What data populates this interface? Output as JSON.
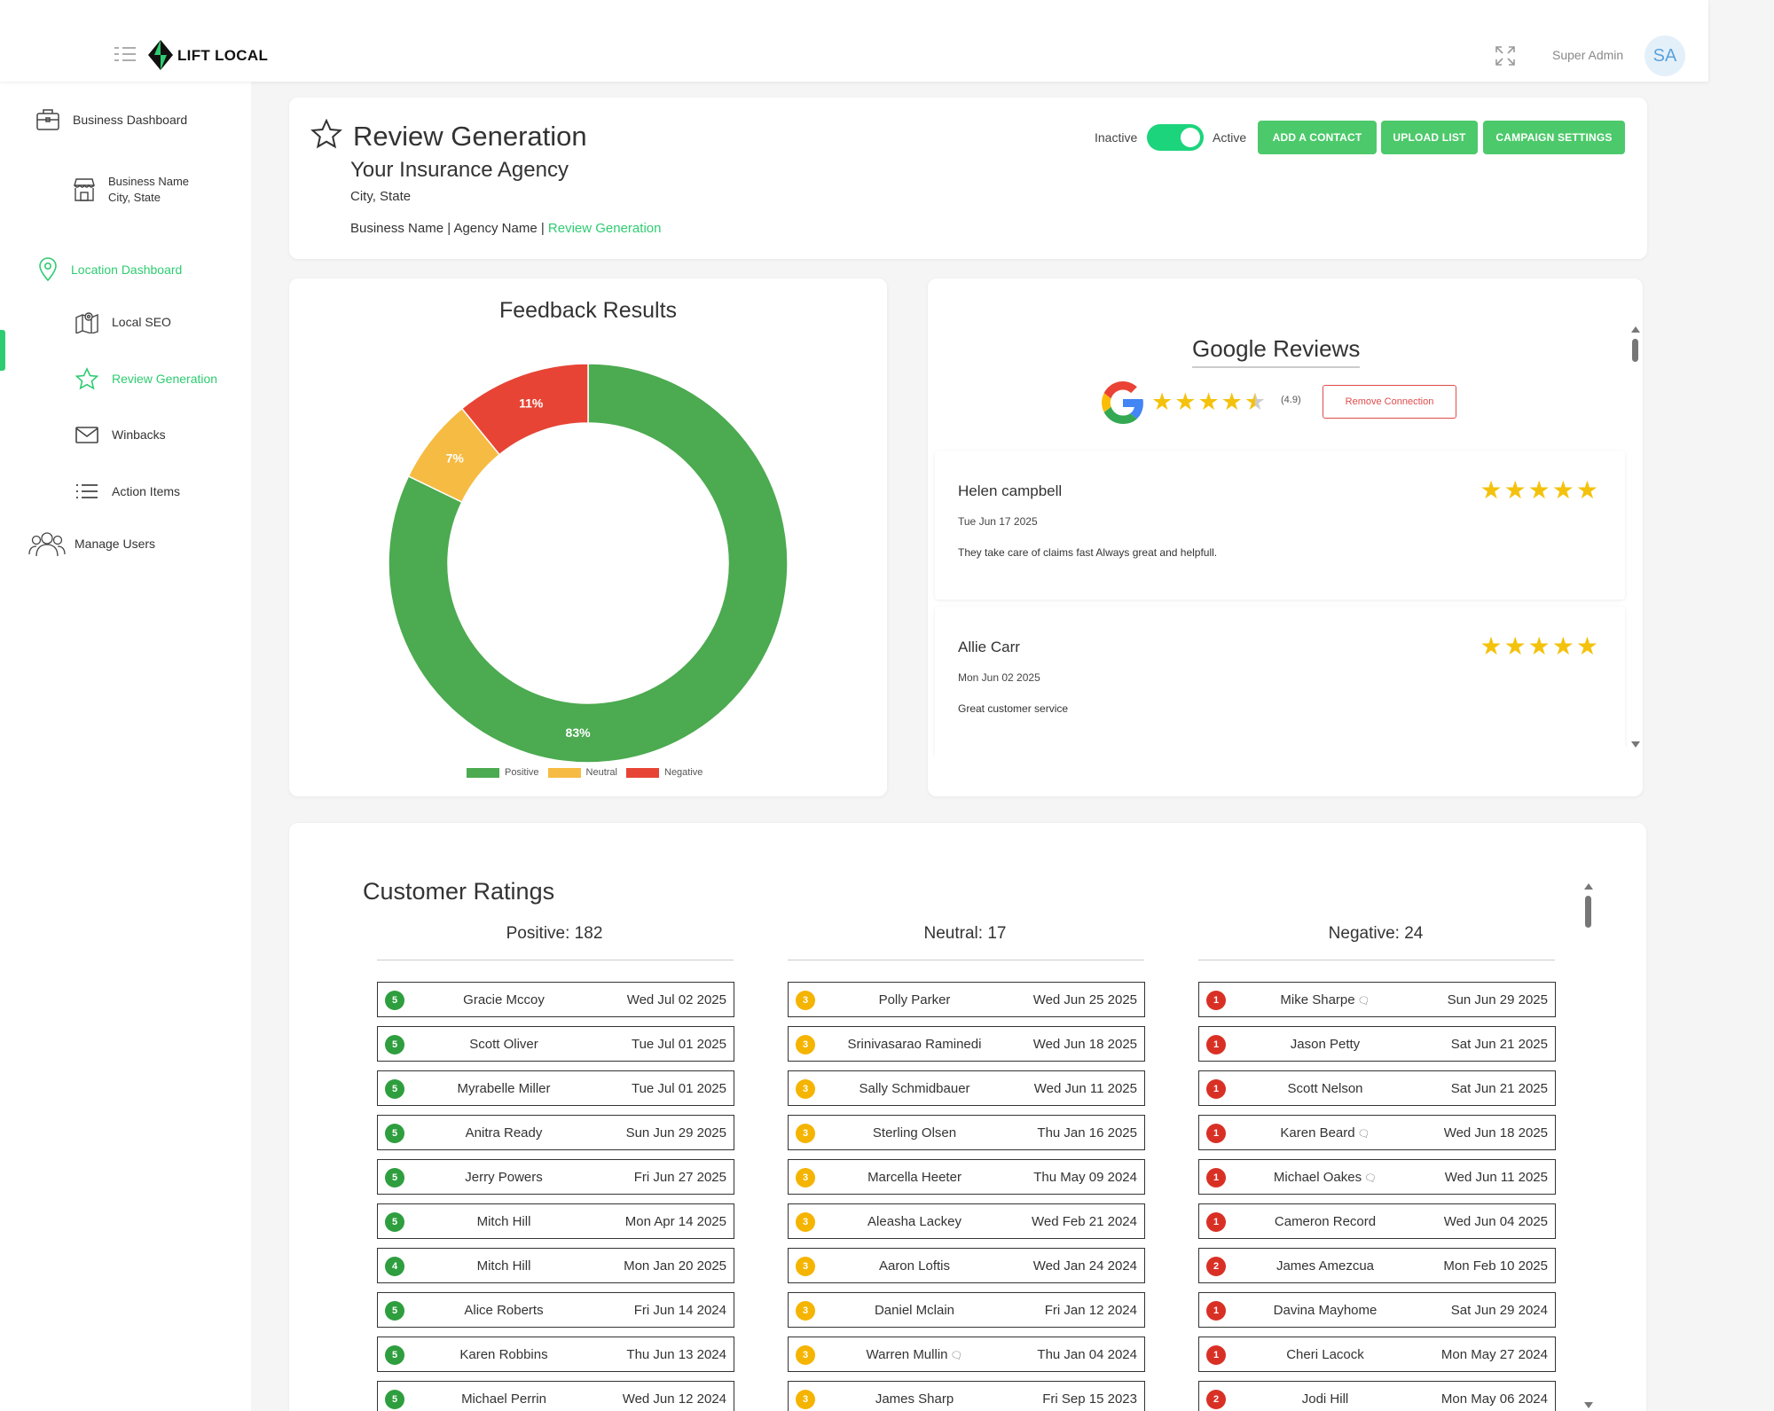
{
  "app": {
    "logo_text": "LIFT LOCAL",
    "user_name": "Super Admin",
    "avatar_initials": "SA"
  },
  "sidebar": {
    "business_dashboard": "Business Dashboard",
    "business_name_line1": "Business Name",
    "business_name_line2": "City, State",
    "location_dashboard": "Location Dashboard",
    "local_seo": "Local SEO",
    "review_generation": "Review Generation",
    "winbacks": "Winbacks",
    "action_items": "Action Items",
    "manage_users": "Manage Users"
  },
  "header": {
    "title": "Review Generation",
    "agency": "Your Insurance Agency",
    "location": "City, State",
    "breadcrumb_prefix": "Business Name | Agency Name | ",
    "breadcrumb_current": "Review Generation",
    "toggle_off_label": "Inactive",
    "toggle_on_label": "Active",
    "toggle_state": true,
    "btn_add_contact": "ADD A CONTACT",
    "btn_upload_list": "UPLOAD LIST",
    "btn_campaign_settings": "CAMPAIGN SETTINGS"
  },
  "colors": {
    "accent": "#2ecc71",
    "positive": "#4caa50",
    "neutral": "#f6bb42",
    "negative": "#e74435",
    "star": "#f4c20d"
  },
  "chart_data": {
    "type": "pie",
    "title": "Feedback Results",
    "categories": [
      "Positive",
      "Neutral",
      "Negative"
    ],
    "values": [
      83,
      7,
      11
    ],
    "labels": [
      "83%",
      "7%",
      "11%"
    ],
    "colors": [
      "#4caa50",
      "#f6bb42",
      "#e74435"
    ],
    "legend": "bottom",
    "donut": true
  },
  "google": {
    "title": "Google Reviews",
    "rating": 4.5,
    "score_text": "(4.9)",
    "remove_label": "Remove Connection",
    "reviews": [
      {
        "name": "Helen campbell",
        "date": "Tue Jun 17 2025",
        "text": "They take care of claims fast Always great and helpfull.",
        "stars": 5
      },
      {
        "name": "Allie Carr",
        "date": "Mon Jun 02 2025",
        "text": "Great customer service",
        "stars": 5
      }
    ]
  },
  "ratings": {
    "title": "Customer Ratings",
    "columns": [
      {
        "header": "Positive: 182",
        "color": "#2e9e3e",
        "rows": [
          {
            "score": "5",
            "name": "Gracie Mccoy",
            "date": "Wed Jul 02 2025",
            "comment": false
          },
          {
            "score": "5",
            "name": "Scott Oliver",
            "date": "Tue Jul 01 2025",
            "comment": false
          },
          {
            "score": "5",
            "name": "Myrabelle Miller",
            "date": "Tue Jul 01 2025",
            "comment": false
          },
          {
            "score": "5",
            "name": "Anitra Ready",
            "date": "Sun Jun 29 2025",
            "comment": false
          },
          {
            "score": "5",
            "name": "Jerry Powers",
            "date": "Fri Jun 27 2025",
            "comment": false
          },
          {
            "score": "5",
            "name": "Mitch Hill",
            "date": "Mon Apr 14 2025",
            "comment": false
          },
          {
            "score": "4",
            "name": "Mitch Hill",
            "date": "Mon Jan 20 2025",
            "comment": false
          },
          {
            "score": "5",
            "name": "Alice Roberts",
            "date": "Fri Jun 14 2024",
            "comment": false
          },
          {
            "score": "5",
            "name": "Karen Robbins",
            "date": "Thu Jun 13 2024",
            "comment": false
          },
          {
            "score": "5",
            "name": "Michael Perrin",
            "date": "Wed Jun 12 2024",
            "comment": false
          }
        ]
      },
      {
        "header": "Neutral: 17",
        "color": "#f4b400",
        "rows": [
          {
            "score": "3",
            "name": "Polly Parker",
            "date": "Wed Jun 25 2025",
            "comment": false
          },
          {
            "score": "3",
            "name": "Srinivasarao Raminedi",
            "date": "Wed Jun 18 2025",
            "comment": false
          },
          {
            "score": "3",
            "name": "Sally Schmidbauer",
            "date": "Wed Jun 11 2025",
            "comment": false
          },
          {
            "score": "3",
            "name": "Sterling Olsen",
            "date": "Thu Jan 16 2025",
            "comment": false
          },
          {
            "score": "3",
            "name": "Marcella Heeter",
            "date": "Thu May 09 2024",
            "comment": false
          },
          {
            "score": "3",
            "name": "Aleasha Lackey",
            "date": "Wed Feb 21 2024",
            "comment": false
          },
          {
            "score": "3",
            "name": "Aaron Loftis",
            "date": "Wed Jan 24 2024",
            "comment": false
          },
          {
            "score": "3",
            "name": "Daniel Mclain",
            "date": "Fri Jan 12 2024",
            "comment": false
          },
          {
            "score": "3",
            "name": "Warren Mullin",
            "date": "Thu Jan 04 2024",
            "comment": true
          },
          {
            "score": "3",
            "name": "James Sharp",
            "date": "Fri Sep 15 2023",
            "comment": false
          }
        ]
      },
      {
        "header": "Negative: 24",
        "color": "#d93025",
        "rows": [
          {
            "score": "1",
            "name": "Mike Sharpe",
            "date": "Sun Jun 29 2025",
            "comment": true
          },
          {
            "score": "1",
            "name": "Jason Petty",
            "date": "Sat Jun 21 2025",
            "comment": false
          },
          {
            "score": "1",
            "name": "Scott Nelson",
            "date": "Sat Jun 21 2025",
            "comment": false
          },
          {
            "score": "1",
            "name": "Karen Beard",
            "date": "Wed Jun 18 2025",
            "comment": true
          },
          {
            "score": "1",
            "name": "Michael Oakes",
            "date": "Wed Jun 11 2025",
            "comment": true
          },
          {
            "score": "1",
            "name": "Cameron Record",
            "date": "Wed Jun 04 2025",
            "comment": false
          },
          {
            "score": "2",
            "name": "James Amezcua",
            "date": "Mon Feb 10 2025",
            "comment": false
          },
          {
            "score": "1",
            "name": "Davina Mayhome",
            "date": "Sat Jun 29 2024",
            "comment": false
          },
          {
            "score": "1",
            "name": "Cheri Lacock",
            "date": "Mon May 27 2024",
            "comment": false
          },
          {
            "score": "2",
            "name": "Jodi Hill",
            "date": "Mon May 06 2024",
            "comment": false
          }
        ]
      }
    ]
  }
}
